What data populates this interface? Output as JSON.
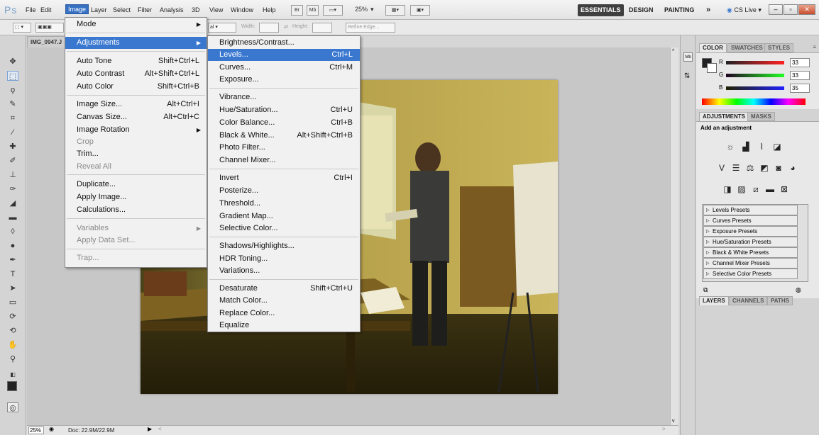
{
  "app": {
    "logo": "Ps"
  },
  "menubar": {
    "items": [
      "File",
      "Edit",
      "Image",
      "Layer",
      "Select",
      "Filter",
      "Analysis",
      "3D",
      "View",
      "Window",
      "Help"
    ],
    "bridge_label": "Br",
    "minibridge_label": "Mb",
    "zoom_label": "25%"
  },
  "workspace": {
    "essentials": "ESSENTIALS",
    "design": "DESIGN",
    "painting": "PAINTING",
    "more": "»",
    "cslive": "CS Live ▾"
  },
  "options_bar": {
    "style_value": "al",
    "width_label": "Width:",
    "height_label": "Height:",
    "refine_edge": "Refine Edge..."
  },
  "document": {
    "tab_title": "IMG_0947.J",
    "zoom": "25%",
    "doc_info": "Doc: 22.9M/22.9M"
  },
  "image_menu": {
    "items": [
      {
        "label": "Mode",
        "submenu": true
      },
      {
        "label": "Adjustments",
        "submenu": true,
        "highlighted": true
      },
      {
        "label": "Auto Tone",
        "shortcut": "Shift+Ctrl+L"
      },
      {
        "label": "Auto Contrast",
        "shortcut": "Alt+Shift+Ctrl+L"
      },
      {
        "label": "Auto Color",
        "shortcut": "Shift+Ctrl+B"
      },
      {
        "label": "Image Size...",
        "shortcut": "Alt+Ctrl+I"
      },
      {
        "label": "Canvas Size...",
        "shortcut": "Alt+Ctrl+C"
      },
      {
        "label": "Image Rotation",
        "submenu": true
      },
      {
        "label": "Crop",
        "disabled": true
      },
      {
        "label": "Trim..."
      },
      {
        "label": "Reveal All",
        "disabled": true
      },
      {
        "label": "Duplicate..."
      },
      {
        "label": "Apply Image..."
      },
      {
        "label": "Calculations..."
      },
      {
        "label": "Variables",
        "submenu": true,
        "disabled": true
      },
      {
        "label": "Apply Data Set...",
        "disabled": true
      },
      {
        "label": "Trap...",
        "disabled": true
      }
    ]
  },
  "adjustments_menu": {
    "items": [
      {
        "label": "Brightness/Contrast..."
      },
      {
        "label": "Levels...",
        "shortcut": "Ctrl+L",
        "highlighted": true
      },
      {
        "label": "Curves...",
        "shortcut": "Ctrl+M"
      },
      {
        "label": "Exposure..."
      },
      {
        "label": "Vibrance..."
      },
      {
        "label": "Hue/Saturation...",
        "shortcut": "Ctrl+U"
      },
      {
        "label": "Color Balance...",
        "shortcut": "Ctrl+B"
      },
      {
        "label": "Black & White...",
        "shortcut": "Alt+Shift+Ctrl+B"
      },
      {
        "label": "Photo Filter..."
      },
      {
        "label": "Channel Mixer..."
      },
      {
        "label": "Invert",
        "shortcut": "Ctrl+I"
      },
      {
        "label": "Posterize..."
      },
      {
        "label": "Threshold..."
      },
      {
        "label": "Gradient Map..."
      },
      {
        "label": "Selective Color..."
      },
      {
        "label": "Shadows/Highlights..."
      },
      {
        "label": "HDR Toning..."
      },
      {
        "label": "Variations..."
      },
      {
        "label": "Desaturate",
        "shortcut": "Shift+Ctrl+U"
      },
      {
        "label": "Match Color..."
      },
      {
        "label": "Replace Color..."
      },
      {
        "label": "Equalize"
      }
    ]
  },
  "color_panel": {
    "tabs": [
      "COLOR",
      "SWATCHES",
      "STYLES"
    ],
    "r_label": "R",
    "g_label": "G",
    "b_label": "B",
    "r": "33",
    "g": "33",
    "b": "35"
  },
  "adjustments_panel": {
    "tabs": [
      "ADJUSTMENTS",
      "MASKS"
    ],
    "heading": "Add an adjustment",
    "presets": [
      "Levels Presets",
      "Curves Presets",
      "Exposure Presets",
      "Hue/Saturation Presets",
      "Black & White Presets",
      "Channel Mixer Presets",
      "Selective Color Presets"
    ]
  },
  "layers_panel": {
    "tabs": [
      "LAYERS",
      "CHANNELS",
      "PATHS"
    ]
  },
  "colors": {
    "highlight": "#3a78d0",
    "photo_wall": "#c9b45a"
  }
}
